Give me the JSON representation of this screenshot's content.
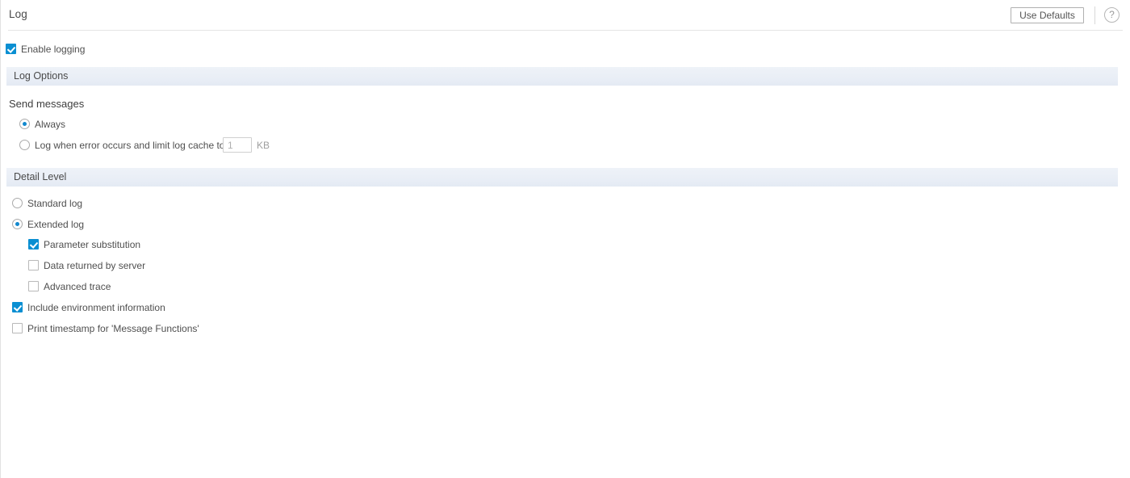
{
  "header": {
    "title": "Log",
    "use_defaults_label": "Use Defaults",
    "help_icon": "question-mark-icon",
    "help_glyph": "?"
  },
  "enable_logging": {
    "label": "Enable logging",
    "checked": true
  },
  "sections": {
    "log_options": {
      "title": "Log Options",
      "group_heading": "Send messages",
      "options": [
        {
          "label": "Always",
          "selected": true
        },
        {
          "label": "Log when error occurs and limit log cache to",
          "selected": false
        }
      ],
      "cache_input": {
        "value": "1",
        "unit": "KB"
      }
    },
    "detail_level": {
      "title": "Detail Level",
      "radios": [
        {
          "label": "Standard log",
          "selected": false
        },
        {
          "label": "Extended log",
          "selected": true
        }
      ],
      "sub_checkboxes": [
        {
          "label": "Parameter substitution",
          "checked": true
        },
        {
          "label": "Data returned by server",
          "checked": false
        },
        {
          "label": "Advanced trace",
          "checked": false
        }
      ],
      "checkboxes": [
        {
          "label": "Include environment information",
          "checked": true
        },
        {
          "label": "Print timestamp for 'Message Functions'",
          "checked": false
        }
      ]
    }
  },
  "colors": {
    "accent": "#0a8fd2",
    "radio_dot": "#1288ce",
    "section_bar": "#e9eef6",
    "text": "#4f4f4f",
    "border": "#e2e2e2"
  }
}
